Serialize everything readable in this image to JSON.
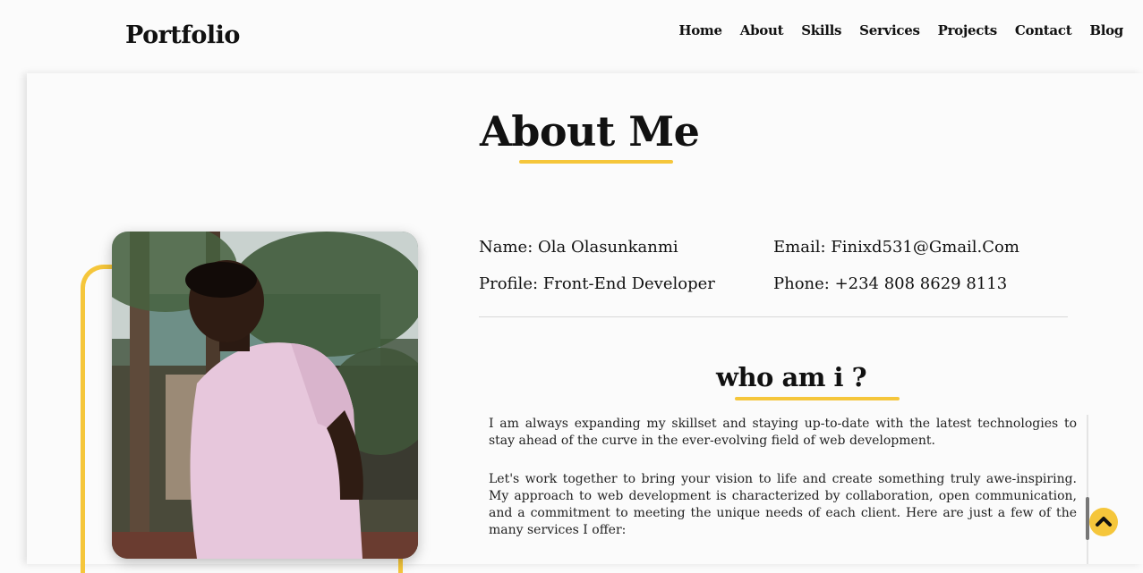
{
  "header": {
    "logo": "Portfolio",
    "nav": [
      "Home",
      "About",
      "Skills",
      "Services",
      "Projects",
      "Contact",
      "Blog"
    ]
  },
  "about": {
    "title": "About Me",
    "info": {
      "name": "Name: Ola Olasunkanmi",
      "email": "Email: Finixd531@Gmail.Com",
      "profile": "Profile: Front-End Developer",
      "phone": "Phone: +234 808 8629 8113"
    },
    "subtitle": "who am i ?",
    "paragraphs": [
      "I am always expanding my skillset and staying up-to-date with the latest technologies to stay ahead of the curve in the ever-evolving field of web development.",
      "Let's work together to bring your vision to life and create something truly awe-inspiring. My approach to web development is characterized by collaboration, open communication, and a commitment to meeting the unique needs of each client. Here are just a few of the many services I offer:"
    ]
  },
  "colors": {
    "accent": "#f5c63b",
    "background": "#fbfbfb",
    "text": "#111111"
  },
  "icons": {
    "back_to_top": "chevron-up-icon"
  }
}
